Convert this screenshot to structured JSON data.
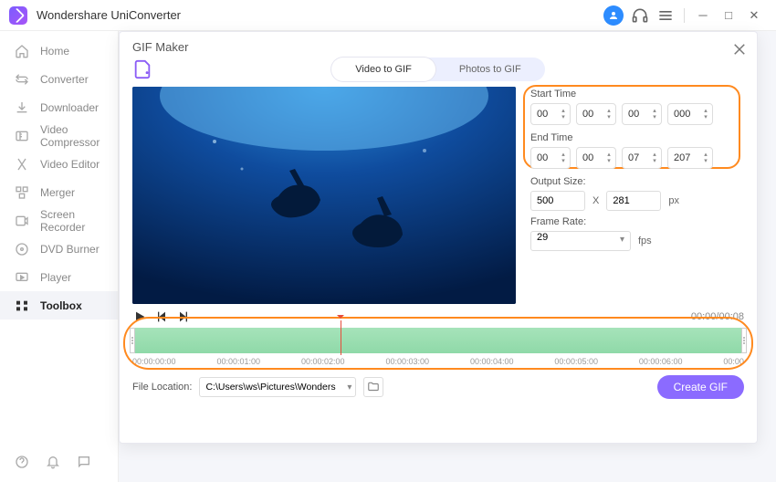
{
  "app": {
    "title": "Wondershare UniConverter"
  },
  "sidebar": {
    "items": [
      {
        "label": "Home",
        "icon": "home-icon"
      },
      {
        "label": "Converter",
        "icon": "converter-icon"
      },
      {
        "label": "Downloader",
        "icon": "download-icon"
      },
      {
        "label": "Video Compressor",
        "icon": "compress-icon"
      },
      {
        "label": "Video Editor",
        "icon": "editor-icon"
      },
      {
        "label": "Merger",
        "icon": "merger-icon"
      },
      {
        "label": "Screen Recorder",
        "icon": "recorder-icon"
      },
      {
        "label": "DVD Burner",
        "icon": "dvd-icon"
      },
      {
        "label": "Player",
        "icon": "player-icon"
      },
      {
        "label": "Toolbox",
        "icon": "toolbox-icon"
      }
    ],
    "active_index": 9
  },
  "gifmaker": {
    "title": "GIF Maker",
    "tabs": {
      "video": "Video to GIF",
      "photos": "Photos to GIF",
      "active": "video"
    },
    "start_label": "Start Time",
    "end_label": "End Time",
    "start": {
      "h": "00",
      "m": "00",
      "s": "00",
      "ms": "000"
    },
    "end": {
      "h": "00",
      "m": "00",
      "s": "07",
      "ms": "207"
    },
    "output_label": "Output Size:",
    "output": {
      "w": "500",
      "h": "281",
      "unit": "px",
      "x": "X"
    },
    "fps_label": "Frame Rate:",
    "fps_value": "29",
    "fps_unit": "fps",
    "transport_time": "00:00/00:08",
    "ruler": [
      "00:00:00:00",
      "00:00:01:00",
      "00:00:02:00",
      "00:00:03:00",
      "00:00:04:00",
      "00:00:05:00",
      "00:00:06:00",
      "00:00"
    ],
    "file_loc_label": "File Location:",
    "file_path": "C:\\Users\\ws\\Pictures\\Wonders",
    "create_label": "Create GIF"
  },
  "colors": {
    "accent": "#8b6bff",
    "highlight": "#ff8a1f"
  }
}
